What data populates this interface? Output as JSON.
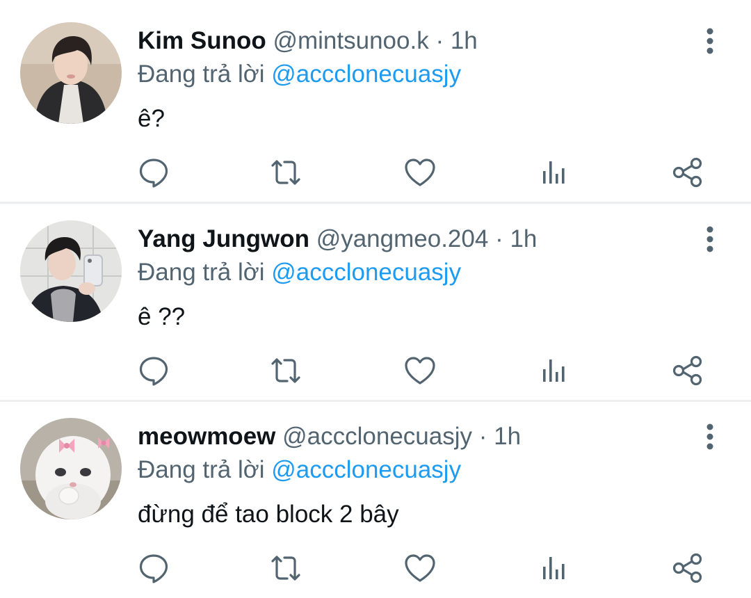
{
  "tweets": [
    {
      "display_name": "Kim Sunoo",
      "handle": "@mintsunoo.k",
      "separator": "·",
      "time": "1h",
      "reply_prefix": "Đang trả lời",
      "reply_to": "@accclonecuasjy",
      "text": "ê?"
    },
    {
      "display_name": "Yang Jungwon",
      "handle": "@yangmeo.204",
      "separator": "·",
      "time": "1h",
      "reply_prefix": "Đang trả lời",
      "reply_to": "@accclonecuasjy",
      "text": "ê ??"
    },
    {
      "display_name": "meowmoew",
      "handle": "@accclonecuasjy",
      "separator": "·",
      "time": "1h",
      "reply_prefix": "Đang trả lời",
      "reply_to": "@accclonecuasjy",
      "text": "đừng để tao block 2 bây"
    }
  ],
  "icons": {
    "reply": "reply-icon",
    "retweet": "retweet-icon",
    "like": "heart-icon",
    "views": "views-icon",
    "share": "share-icon",
    "more": "more-vertical-icon"
  },
  "colors": {
    "primary_text": "#0f1419",
    "secondary_text": "#536471",
    "link": "#1d9bf0",
    "icon": "#536471",
    "divider": "#eceef0"
  }
}
